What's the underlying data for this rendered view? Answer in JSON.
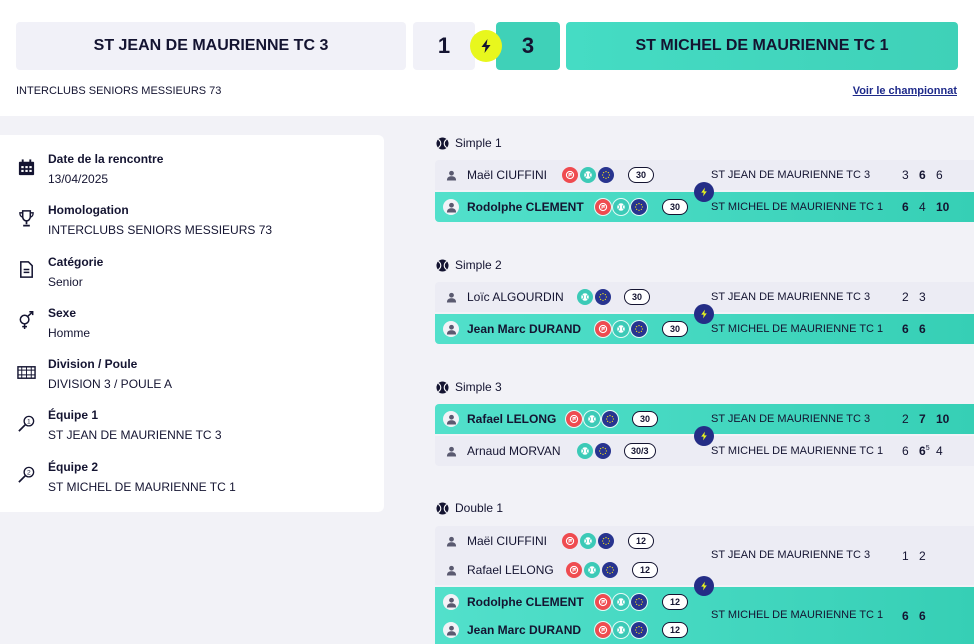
{
  "header": {
    "team1": "ST JEAN DE MAURIENNE TC 3",
    "team2": "ST MICHEL DE MAURIENNE TC 1",
    "score1": "1",
    "score2": "3",
    "competition": "INTERCLUBS SENIORS MESSIEURS 73",
    "championship_link": "Voir le championnat"
  },
  "info": {
    "date": {
      "label": "Date de la rencontre",
      "value": "13/04/2025",
      "icon": "calendar-icon"
    },
    "homologation": {
      "label": "Homologation",
      "value": "INTERCLUBS SENIORS MESSIEURS 73",
      "icon": "trophy-icon"
    },
    "category": {
      "label": "Catégorie",
      "value": "Senior",
      "icon": "document-icon"
    },
    "sex": {
      "label": "Sexe",
      "value": "Homme",
      "icon": "gender-icon"
    },
    "division": {
      "label": "Division / Poule",
      "value": "DIVISION 3 / POULE A",
      "icon": "grid-icon"
    },
    "team1": {
      "label": "Équipe 1",
      "value": "ST JEAN DE MAURIENNE TC 3",
      "icon": "racket-1-icon"
    },
    "team2": {
      "label": "Équipe 2",
      "value": "ST MICHEL DE MAURIENNE TC 1",
      "icon": "racket-2-icon"
    }
  },
  "matches": {
    "s1": {
      "title": "Simple 1",
      "p1": {
        "name": "Maël CIUFFINI",
        "rank": "30",
        "club": "ST JEAN DE MAURIENNE TC 3",
        "sets": [
          "3",
          "6",
          "6"
        ]
      },
      "p2": {
        "name": "Rodolphe CLEMENT",
        "rank": "30",
        "club": "ST MICHEL DE MAURIENNE TC 1",
        "sets": [
          "6",
          "4",
          "10"
        ]
      }
    },
    "s2": {
      "title": "Simple 2",
      "p1": {
        "name": "Loïc ALGOURDIN",
        "rank": "30",
        "club": "ST JEAN DE MAURIENNE TC 3",
        "sets": [
          "2",
          "3"
        ]
      },
      "p2": {
        "name": "Jean Marc DURAND",
        "rank": "30",
        "club": "ST MICHEL DE MAURIENNE TC 1",
        "sets": [
          "6",
          "6"
        ]
      }
    },
    "s3": {
      "title": "Simple 3",
      "p1": {
        "name": "Rafael LELONG",
        "rank": "30",
        "club": "ST JEAN DE MAURIENNE TC 3",
        "sets": [
          "2",
          "7",
          "10"
        ]
      },
      "p2": {
        "name": "Arnaud MORVAN",
        "rank": "30/3",
        "club": "ST MICHEL DE MAURIENNE TC 1",
        "sets": [
          "6",
          "6",
          "4"
        ],
        "tiebreak": "5"
      }
    },
    "d1": {
      "title": "Double 1",
      "p1a": {
        "name": "Maël CIUFFINI",
        "rank": "12"
      },
      "p1b": {
        "name": "Rafael LELONG",
        "rank": "12"
      },
      "club1": "ST JEAN DE MAURIENNE TC 3",
      "sets1": [
        "1",
        "2"
      ],
      "p2a": {
        "name": "Rodolphe CLEMENT",
        "rank": "12"
      },
      "p2b": {
        "name": "Jean Marc DURAND",
        "rank": "12"
      },
      "club2": "ST MICHEL DE MAURIENNE TC 1",
      "sets2": [
        "6",
        "6"
      ]
    }
  },
  "colors": {
    "winner": "#3fd1b8",
    "accent_yellow": "#e8f71d",
    "navy": "#242d86",
    "red": "#ef4b50"
  }
}
